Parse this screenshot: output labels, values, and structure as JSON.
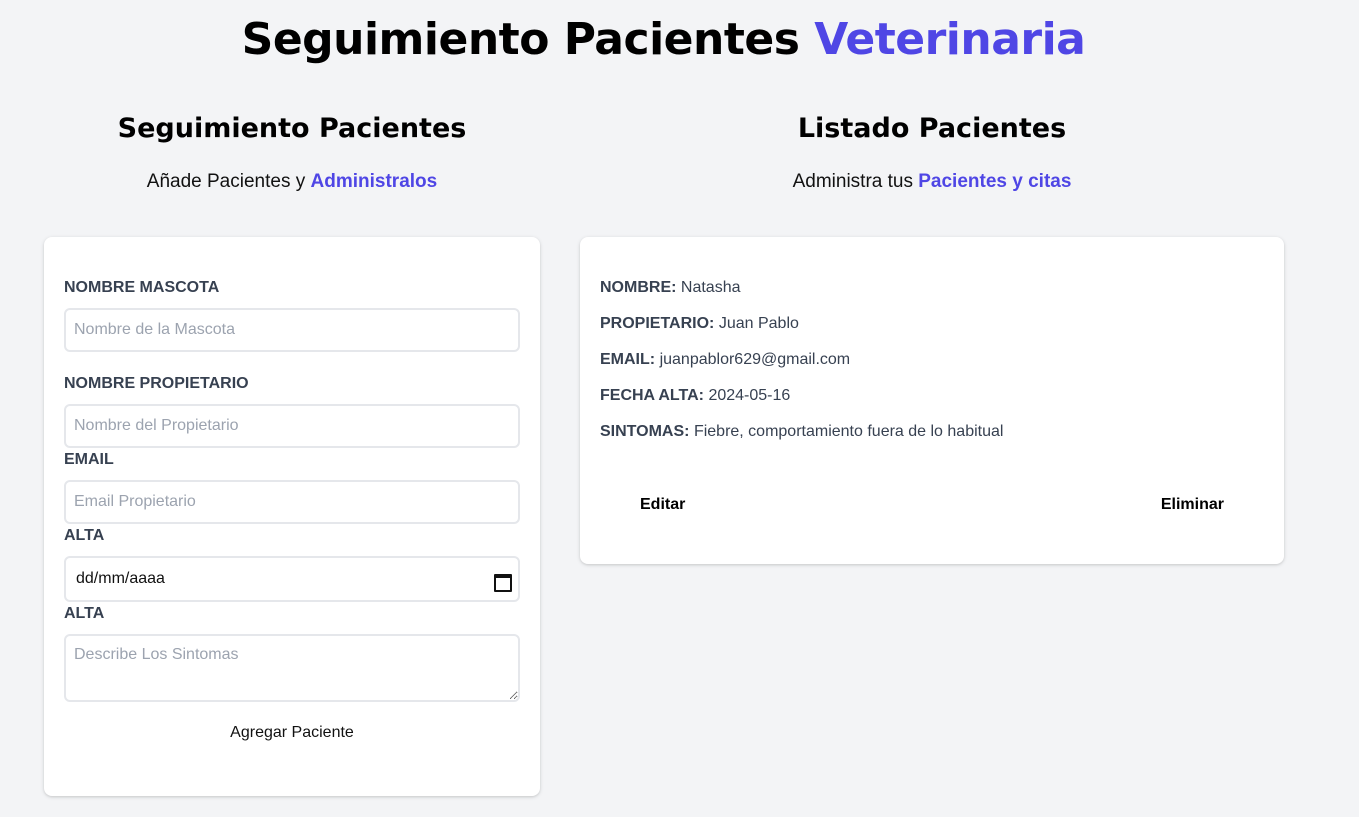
{
  "header": {
    "title_part1": "Seguimiento Pacientes",
    "title_part2": "Veterinaria"
  },
  "form_section": {
    "title": "Seguimiento Pacientes",
    "subtitle_prefix": "Añade Pacientes y",
    "subtitle_accent": "Administralos",
    "fields": {
      "pet_name": {
        "label": "NOMBRE MASCOTA",
        "placeholder": "Nombre de la Mascota",
        "value": ""
      },
      "owner_name": {
        "label": "NOMBRE PROPIETARIO",
        "placeholder": "Nombre del Propietario",
        "value": ""
      },
      "email": {
        "label": "EMAIL",
        "placeholder": "Email Propietario",
        "value": ""
      },
      "date": {
        "label": "ALTA",
        "display": "dd/mm/aaaa"
      },
      "symptoms": {
        "label": "ALTA",
        "placeholder": "Describe Los Sintomas",
        "value": ""
      }
    },
    "submit_label": "Agregar Paciente"
  },
  "list_section": {
    "title": "Listado Pacientes",
    "subtitle_prefix": "Administra tus",
    "subtitle_accent": "Pacientes y citas",
    "patients": [
      {
        "name_label": "NOMBRE:",
        "name": "Natasha",
        "owner_label": "PROPIETARIO:",
        "owner": "Juan Pablo",
        "email_label": "EMAIL:",
        "email": "juanpablor629@gmail.com",
        "date_label": "FECHA ALTA:",
        "date": "2024-05-16",
        "symptoms_label": "SINTOMAS:",
        "symptoms": "Fiebre, comportamiento fuera de lo habitual",
        "edit_label": "Editar",
        "delete_label": "Eliminar"
      }
    ]
  },
  "colors": {
    "accent": "#4f46e5",
    "background": "#f3f4f6",
    "card": "#ffffff"
  }
}
